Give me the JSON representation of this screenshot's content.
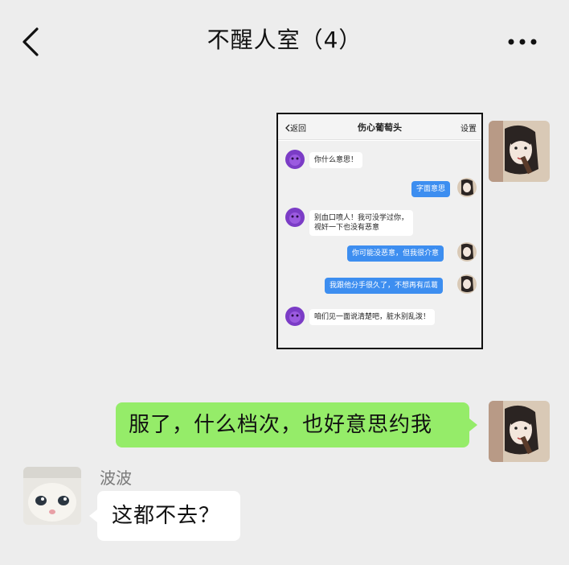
{
  "header": {
    "title": "不醒人室（4）",
    "back_icon": "chevron-left-icon",
    "more_icon": "more-icon"
  },
  "screenshot": {
    "back_label": "返回",
    "title": "伤心葡萄头",
    "settings_label": "设置",
    "messages": [
      {
        "side": "left",
        "text": "你什么意思！"
      },
      {
        "side": "right",
        "text": "字面意思"
      },
      {
        "side": "left",
        "text": "别血口喷人！我可没学过你，",
        "text2": "视奸一下也没有恶意"
      },
      {
        "side": "right",
        "text": "你可能没恶意，但我很介意"
      },
      {
        "side": "right",
        "text": "我跟他分手很久了，不想再有瓜葛"
      },
      {
        "side": "left",
        "text": "咱们见一面说清楚吧，脏水别乱泼！"
      }
    ]
  },
  "chat": {
    "my_message": "服了，什么档次，也好意思约我",
    "other_sender": "波波",
    "other_message": "这都不去？"
  },
  "colors": {
    "background": "#ededed",
    "my_bubble": "#95ec69",
    "other_bubble": "#ffffff",
    "mini_right_bubble": "#3d8ef0"
  }
}
